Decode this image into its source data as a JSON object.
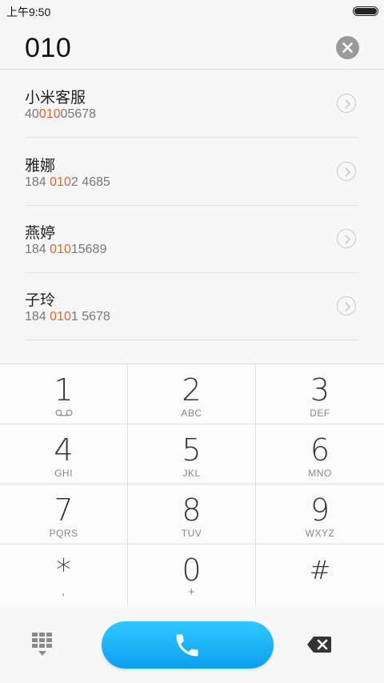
{
  "status": {
    "time": "上午9:50",
    "battery_icon": "battery-icon"
  },
  "input": {
    "number": "010",
    "clear_icon": "clear-icon"
  },
  "results": [
    {
      "name": "小米客服",
      "number_before": "40",
      "number_match": "010",
      "number_after": "05678"
    },
    {
      "name": "雅娜",
      "number_before": "184 ",
      "number_match": "010",
      "number_after": "2 4685"
    },
    {
      "name": "燕婷",
      "number_before": "184 ",
      "number_match": "010",
      "number_after": "15689"
    },
    {
      "name": "子玲",
      "number_before": "184 ",
      "number_match": "010",
      "number_after": "1 5678"
    }
  ],
  "keypad": [
    {
      "digit": "1",
      "letters": ""
    },
    {
      "digit": "2",
      "letters": "ABC"
    },
    {
      "digit": "3",
      "letters": "DEF"
    },
    {
      "digit": "4",
      "letters": "GHI"
    },
    {
      "digit": "5",
      "letters": "JKL"
    },
    {
      "digit": "6",
      "letters": "MNO"
    },
    {
      "digit": "7",
      "letters": "PQRS"
    },
    {
      "digit": "8",
      "letters": "TUV"
    },
    {
      "digit": "9",
      "letters": "WXYZ"
    },
    {
      "digit": "*",
      "letters": ","
    },
    {
      "digit": "0",
      "letters": "+"
    },
    {
      "digit": "#",
      "letters": ""
    }
  ],
  "bottom": {
    "dialpad_icon": "dialpad-grid-icon",
    "call_icon": "phone-icon",
    "backspace_icon": "backspace-icon"
  },
  "colors": {
    "accent": "#f0602c",
    "call": "#15aaf3"
  }
}
